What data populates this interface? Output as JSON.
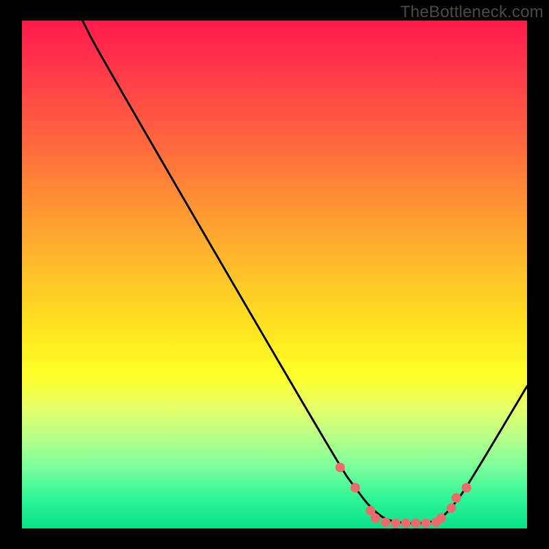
{
  "watermark": "TheBottleneck.com",
  "chart_data": {
    "type": "line",
    "title": "",
    "xlabel": "",
    "ylabel": "",
    "xlim": [
      0,
      100
    ],
    "ylim": [
      0,
      100
    ],
    "series": [
      {
        "name": "curve",
        "x": [
          12,
          15,
          63,
          66,
          69,
          73,
          82,
          85,
          88,
          100
        ],
        "y": [
          100,
          94,
          12,
          8,
          4,
          1,
          1,
          4,
          8,
          28
        ]
      }
    ],
    "markers": {
      "name": "highlight-dots",
      "color": "#ee6b6b",
      "x": [
        63,
        66,
        69,
        70,
        72,
        74,
        76,
        78,
        80,
        82,
        83,
        85,
        86,
        88
      ],
      "y": [
        12,
        8,
        3.5,
        2,
        1.2,
        1,
        1,
        1,
        1,
        1.2,
        2,
        4,
        6,
        8
      ]
    },
    "gradient_stops": [
      {
        "pos": 0,
        "color": "#ff1a4d"
      },
      {
        "pos": 100,
        "color": "#0ae08a"
      }
    ]
  }
}
